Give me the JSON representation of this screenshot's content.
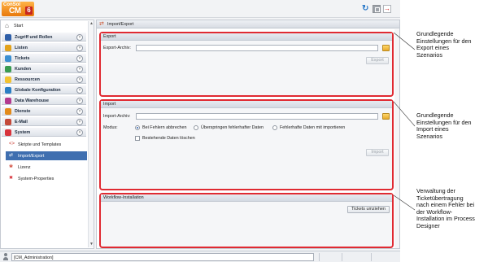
{
  "logo": {
    "line1": "ConSol",
    "line2": "CM",
    "line3": "6"
  },
  "toolbar": {
    "refresh_icon": "refresh-icon",
    "window_icon": "window-icon",
    "logout_icon": "logout-icon"
  },
  "sidebar": {
    "start_label": "Start",
    "items": [
      {
        "label": "Zugriff und Rollen",
        "icon": "key-icon",
        "color": "#2f5fa8"
      },
      {
        "label": "Listen",
        "icon": "list-icon",
        "color": "#e3a21a"
      },
      {
        "label": "Tickets",
        "icon": "ticket-icon",
        "color": "#3c8fd1"
      },
      {
        "label": "Kunden",
        "icon": "customer-icon",
        "color": "#3a9b50"
      },
      {
        "label": "Ressourcen",
        "icon": "resource-icon",
        "color": "#f2c230"
      },
      {
        "label": "Globale Konfiguration",
        "icon": "globe-icon",
        "color": "#2a7ec4"
      },
      {
        "label": "Data Warehouse",
        "icon": "warehouse-icon",
        "color": "#b23a8f"
      },
      {
        "label": "Dienste",
        "icon": "services-icon",
        "color": "#e38b1a"
      },
      {
        "label": "E-Mail",
        "icon": "mail-icon",
        "color": "#c44a3a"
      },
      {
        "label": "System",
        "icon": "gear-icon",
        "color": "#d8343c",
        "expanded": true
      }
    ],
    "subitems": [
      {
        "label": "Skripte und Templates",
        "icon": "script-icon"
      },
      {
        "label": "Import/Export",
        "icon": "import-export-icon",
        "active": true
      },
      {
        "label": "Lizenz",
        "icon": "license-icon"
      },
      {
        "label": "System-Properties",
        "icon": "properties-icon"
      }
    ]
  },
  "main": {
    "title": "Import/Export",
    "export": {
      "header": "Export",
      "archive_label": "Export-Archiv:",
      "archive_value": "",
      "button": "Export"
    },
    "import": {
      "header": "Import",
      "archive_label": "Import-Archiv:",
      "archive_value": "",
      "mode_label": "Modus:",
      "modes": [
        {
          "label": "Bei Fehlern abbrechen",
          "selected": true
        },
        {
          "label": "Überspringen fehlerhafter Daten",
          "selected": false
        },
        {
          "label": "Fehlerhafte Daten mit importieren",
          "selected": false
        }
      ],
      "delete_label": "Bestehende Daten löschen",
      "delete_checked": false,
      "button": "Import"
    },
    "workflow": {
      "header": "Workflow-Installation",
      "button": "Tickets umziehen"
    }
  },
  "statusbar": {
    "user": "[CM_Administration]"
  },
  "annotations": [
    {
      "lines": [
        "Grundlegende",
        "Einstellungen für den",
        "Export eines",
        "Szenarios"
      ]
    },
    {
      "lines": [
        "Grundlegende",
        "Einstellungen für den",
        "Import eines",
        "Szenarios"
      ]
    },
    {
      "lines": [
        "Verwaltung der",
        "Ticketübertragung",
        "nach einem Fehler bei",
        "der Workflow-",
        "Installation im Process",
        "Designer"
      ]
    }
  ]
}
